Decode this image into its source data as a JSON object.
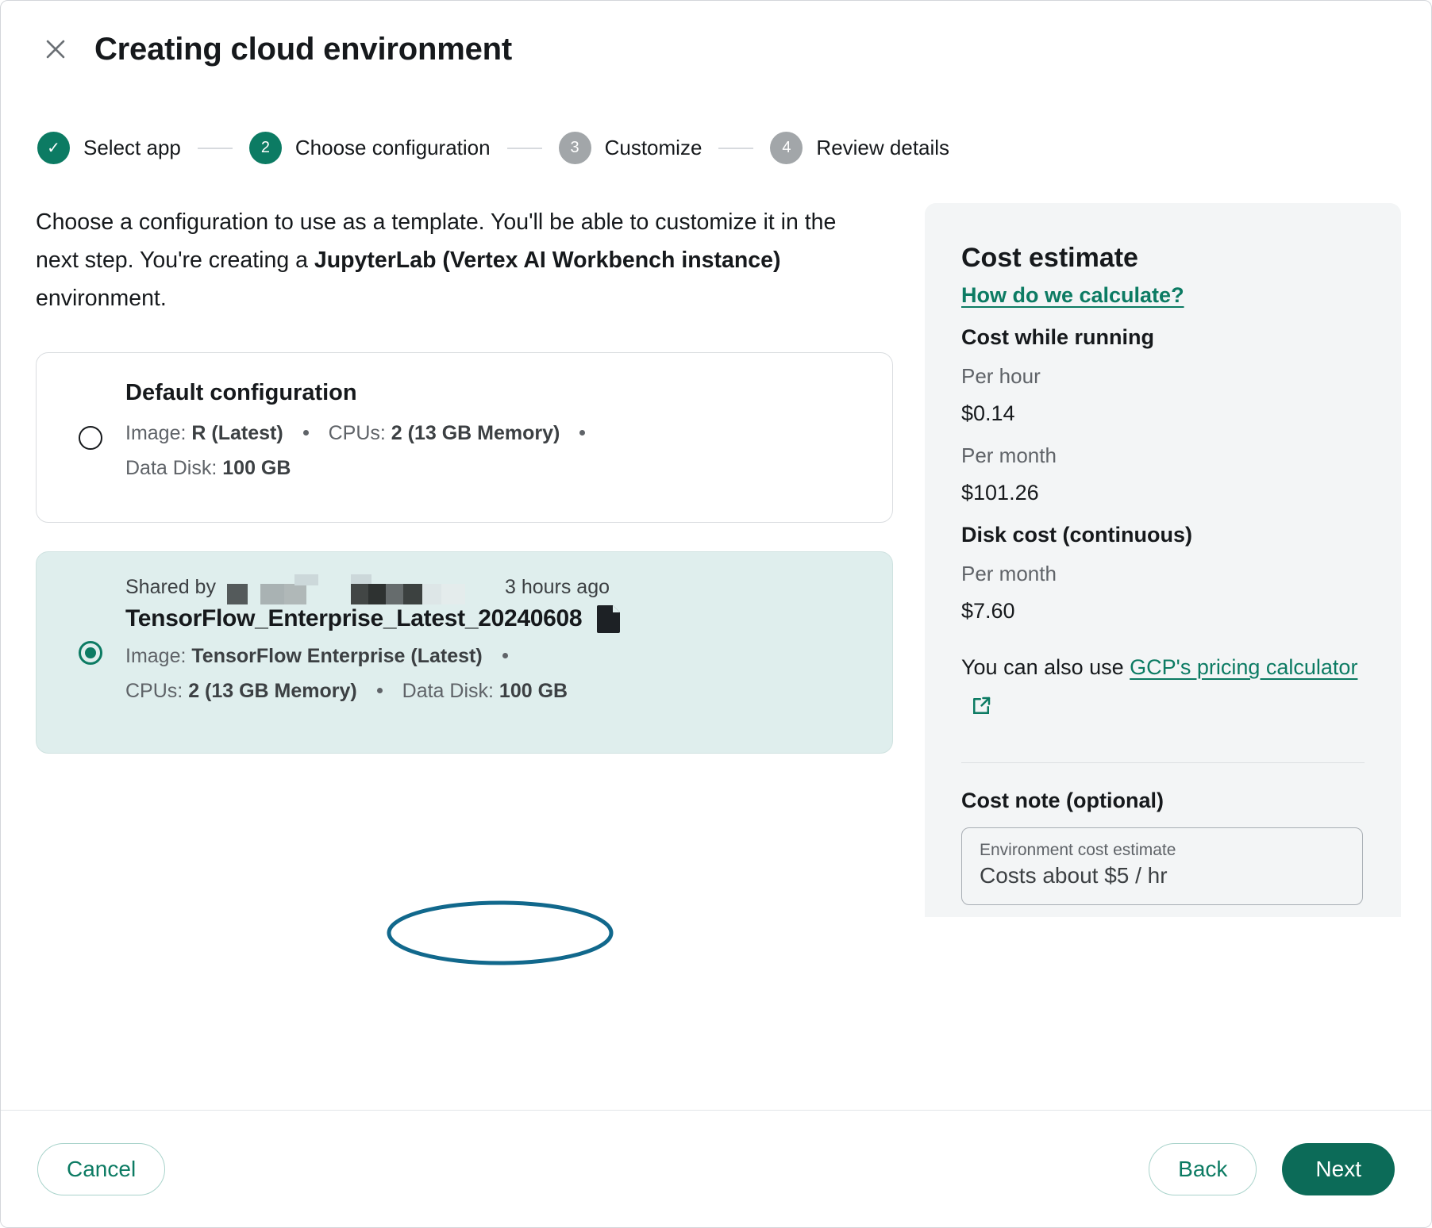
{
  "header": {
    "title": "Creating cloud environment",
    "close_icon": "close-icon"
  },
  "stepper": {
    "steps": [
      {
        "marker": "✓",
        "label": "Select app",
        "state": "done"
      },
      {
        "marker": "2",
        "label": "Choose configuration",
        "state": "current"
      },
      {
        "marker": "3",
        "label": "Customize",
        "state": "todo"
      },
      {
        "marker": "4",
        "label": "Review details",
        "state": "todo"
      }
    ]
  },
  "main": {
    "intro_part1": "Choose a configuration to use as a template. You'll be able to customize it in the next step. You're creating a ",
    "intro_bold": "JupyterLab (Vertex AI Workbench instance)",
    "intro_part2": " environment.",
    "options": [
      {
        "selected": false,
        "heading": "Default configuration",
        "image_key": "Image:",
        "image_value": "R (Latest)",
        "cpus_key": "CPUs:",
        "cpus_value": "2 (13 GB Memory)",
        "disk_key": "Data Disk:",
        "disk_value": "100 GB"
      },
      {
        "selected": true,
        "shared_by_label": "Shared by",
        "shared_time": "3 hours ago",
        "name": "TensorFlow_Enterprise_Latest_20240608",
        "file_icon": "document-icon",
        "image_key": "Image:",
        "image_value": "TensorFlow Enterprise (Latest)",
        "cpus_key": "CPUs:",
        "cpus_value": "2 (13 GB Memory)",
        "disk_key": "Data Disk:",
        "disk_value": "100 GB"
      }
    ],
    "annotation": {
      "shape": "ellipse",
      "color": "#11688c",
      "targets": "Data Disk: 100 GB"
    }
  },
  "cost_panel": {
    "title": "Cost estimate",
    "how_link": "How do we calculate?",
    "running_heading": "Cost while running",
    "per_hour_label": "Per hour",
    "per_hour_value": "$0.14",
    "per_month_label": "Per month",
    "per_month_value": "$101.26",
    "disk_heading": "Disk cost (continuous)",
    "disk_month_label": "Per month",
    "disk_month_value": "$7.60",
    "also_use_prefix": "You can also use ",
    "also_use_link": "GCP's pricing calculator",
    "external_icon": "external-link-icon",
    "note_label": "Cost note (optional)",
    "note_caption": "Environment cost estimate",
    "note_value": "Costs about $5 / hr"
  },
  "footer": {
    "cancel": "Cancel",
    "back": "Back",
    "next": "Next"
  },
  "colors": {
    "accent": "#0c7b63",
    "primary_button": "#0c6b58",
    "selected_card_bg": "#dfeeed",
    "panel_bg": "#f3f5f6",
    "annotation": "#11688c",
    "muted_text": "#5f6368"
  }
}
